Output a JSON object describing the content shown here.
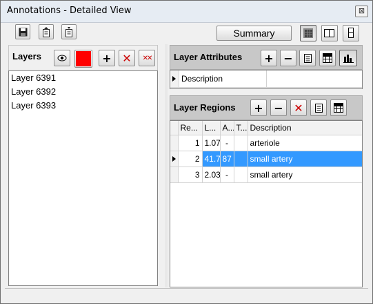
{
  "window": {
    "title": "Annotations - Detailed View",
    "close_glyph": "⊠"
  },
  "toolbar": {
    "summary_label": "Summary"
  },
  "layers": {
    "title": "Layers",
    "color": "#ff0000",
    "items": [
      "Layer 6391",
      "Layer 6392",
      "Layer 6393"
    ]
  },
  "attributes": {
    "title": "Layer Attributes",
    "rows": [
      {
        "label": "Description",
        "value": ""
      }
    ]
  },
  "regions": {
    "title": "Layer Regions",
    "columns": [
      "Re...",
      "L...",
      "A...",
      "T...",
      "Description"
    ],
    "rows": [
      {
        "re": "1",
        "l": "1.07",
        "a": "-",
        "t": "",
        "desc": "arteriole",
        "selected": false
      },
      {
        "re": "2",
        "l": "41.7",
        "a": "87",
        "t": "",
        "desc": "small artery",
        "selected": true
      },
      {
        "re": "3",
        "l": "2.03",
        "a": "-",
        "t": "",
        "desc": "small artery",
        "selected": false
      }
    ]
  }
}
